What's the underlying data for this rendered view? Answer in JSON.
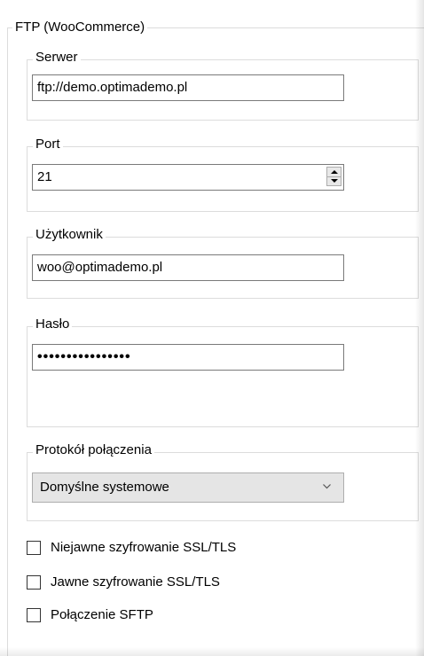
{
  "ftp_group": {
    "title": "FTP (WooCommerce)"
  },
  "server": {
    "title": "Serwer",
    "value": "ftp://demo.optimademo.pl"
  },
  "port": {
    "title": "Port",
    "value": "21"
  },
  "user": {
    "title": "Użytkownik",
    "value": "woo@optimademo.pl"
  },
  "password": {
    "title": "Hasło",
    "masked_value": "••••••••••••••••"
  },
  "protocol": {
    "title": "Protokół połączenia",
    "selected": "Domyślne systemowe"
  },
  "options": [
    {
      "label": "Niejawne szyfrowanie SSL/TLS",
      "checked": false
    },
    {
      "label": "Jawne szyfrowanie SSL/TLS",
      "checked": false
    },
    {
      "label": "Połączenie SFTP",
      "checked": false
    }
  ],
  "icons": {
    "spinner": "spin-up-down-icon",
    "dropdown": "chevron-down-icon"
  }
}
